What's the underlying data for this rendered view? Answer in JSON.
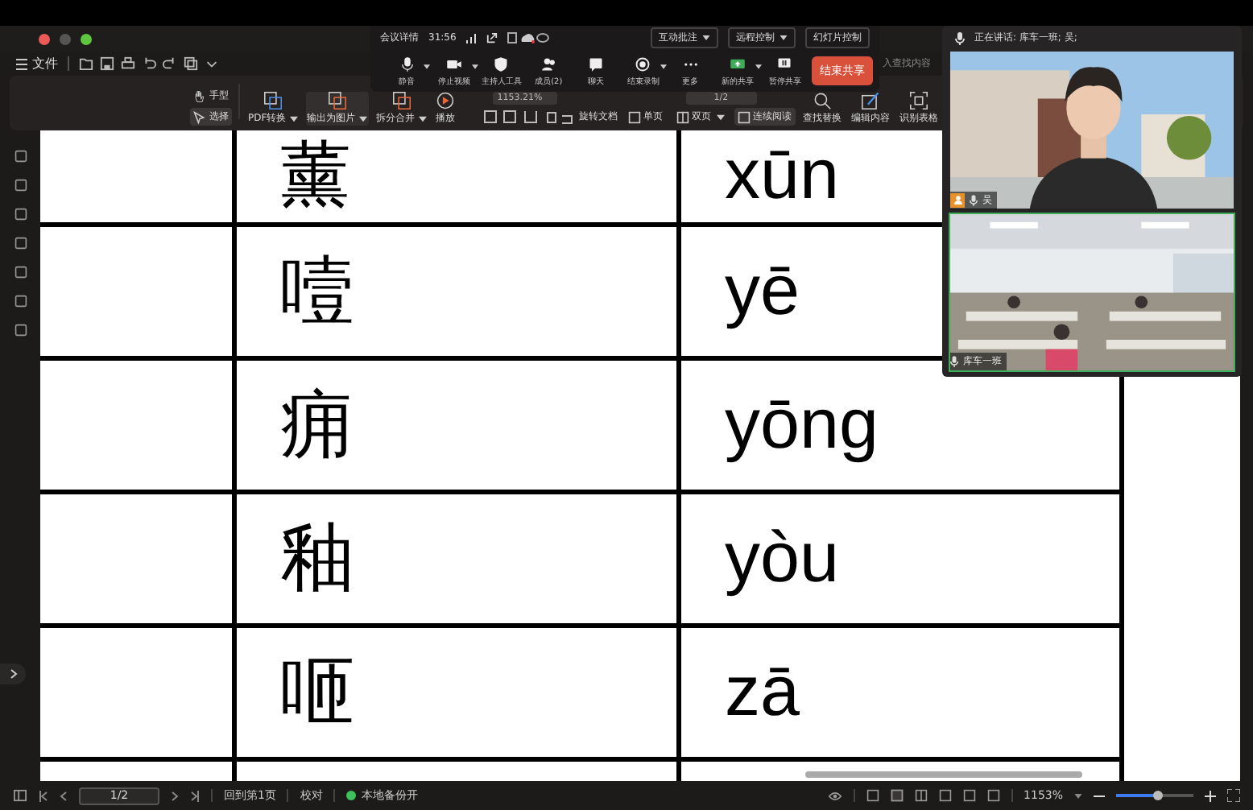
{
  "toolbar": {
    "file_menu": "文件"
  },
  "ribbon": {
    "hand_tool": "手型",
    "select_tool": {
      "label": "选择",
      "selected": true
    },
    "tools": [
      {
        "label": "PDF转换",
        "dropdown": true
      },
      {
        "label": "输出为图片",
        "dropdown": true
      },
      {
        "label": "拆分合并",
        "dropdown": true
      },
      {
        "label": "播放",
        "dropdown": false
      }
    ],
    "zoom_value": "1153.21%",
    "page_value": "1/2",
    "rotate": "旋转文档",
    "view_modes": [
      {
        "label": "单页",
        "selected": false,
        "dropdown": false
      },
      {
        "label": "双页",
        "selected": false,
        "dropdown": true
      },
      {
        "label": "连续阅读",
        "selected": true,
        "dropdown": false
      }
    ],
    "more_tools": [
      "查找替换",
      "编辑内容",
      "识别表格"
    ],
    "search_placeholder": "入查找内容"
  },
  "meeting": {
    "info": "会议详情",
    "timer": "31:56",
    "top_buttons": [
      {
        "label": "互动批注",
        "dropdown": true
      },
      {
        "label": "远程控制",
        "dropdown": true
      },
      {
        "label": "幻灯片控制",
        "dropdown": false
      }
    ],
    "buttons": [
      {
        "label": "静音",
        "dropdown": true
      },
      {
        "label": "停止视频",
        "dropdown": true
      },
      {
        "label": "主持人工具",
        "dropdown": false
      },
      {
        "label": "成员(2)",
        "dropdown": false
      },
      {
        "label": "聊天",
        "dropdown": false
      },
      {
        "label": "结束录制",
        "dropdown": true
      },
      {
        "label": "更多",
        "dropdown": false
      },
      {
        "label": "新的共享",
        "dropdown": true
      },
      {
        "label": "暂停共享",
        "dropdown": false
      }
    ],
    "end_button": "结束共享"
  },
  "video_panel": {
    "speaking": "正在讲话: 库车一班; 吴;",
    "tiles": [
      {
        "name": "吴",
        "selected": false
      },
      {
        "name": "库车一班",
        "selected": true
      }
    ]
  },
  "document": {
    "rows": [
      {
        "character": "薰",
        "pinyin": "xūn"
      },
      {
        "character": "噎",
        "pinyin": "yē"
      },
      {
        "character": "痈",
        "pinyin": "yōng"
      },
      {
        "character": "釉",
        "pinyin": "yòu"
      },
      {
        "character": "咂",
        "pinyin": "zā"
      }
    ]
  },
  "status_bar": {
    "page": "1/2",
    "go_first": "回到第1页",
    "proofread": "校对",
    "backup": {
      "label": "本地备份开",
      "on": true
    },
    "zoom": "1153%",
    "zoom_slider": {
      "level": 0.55
    }
  }
}
